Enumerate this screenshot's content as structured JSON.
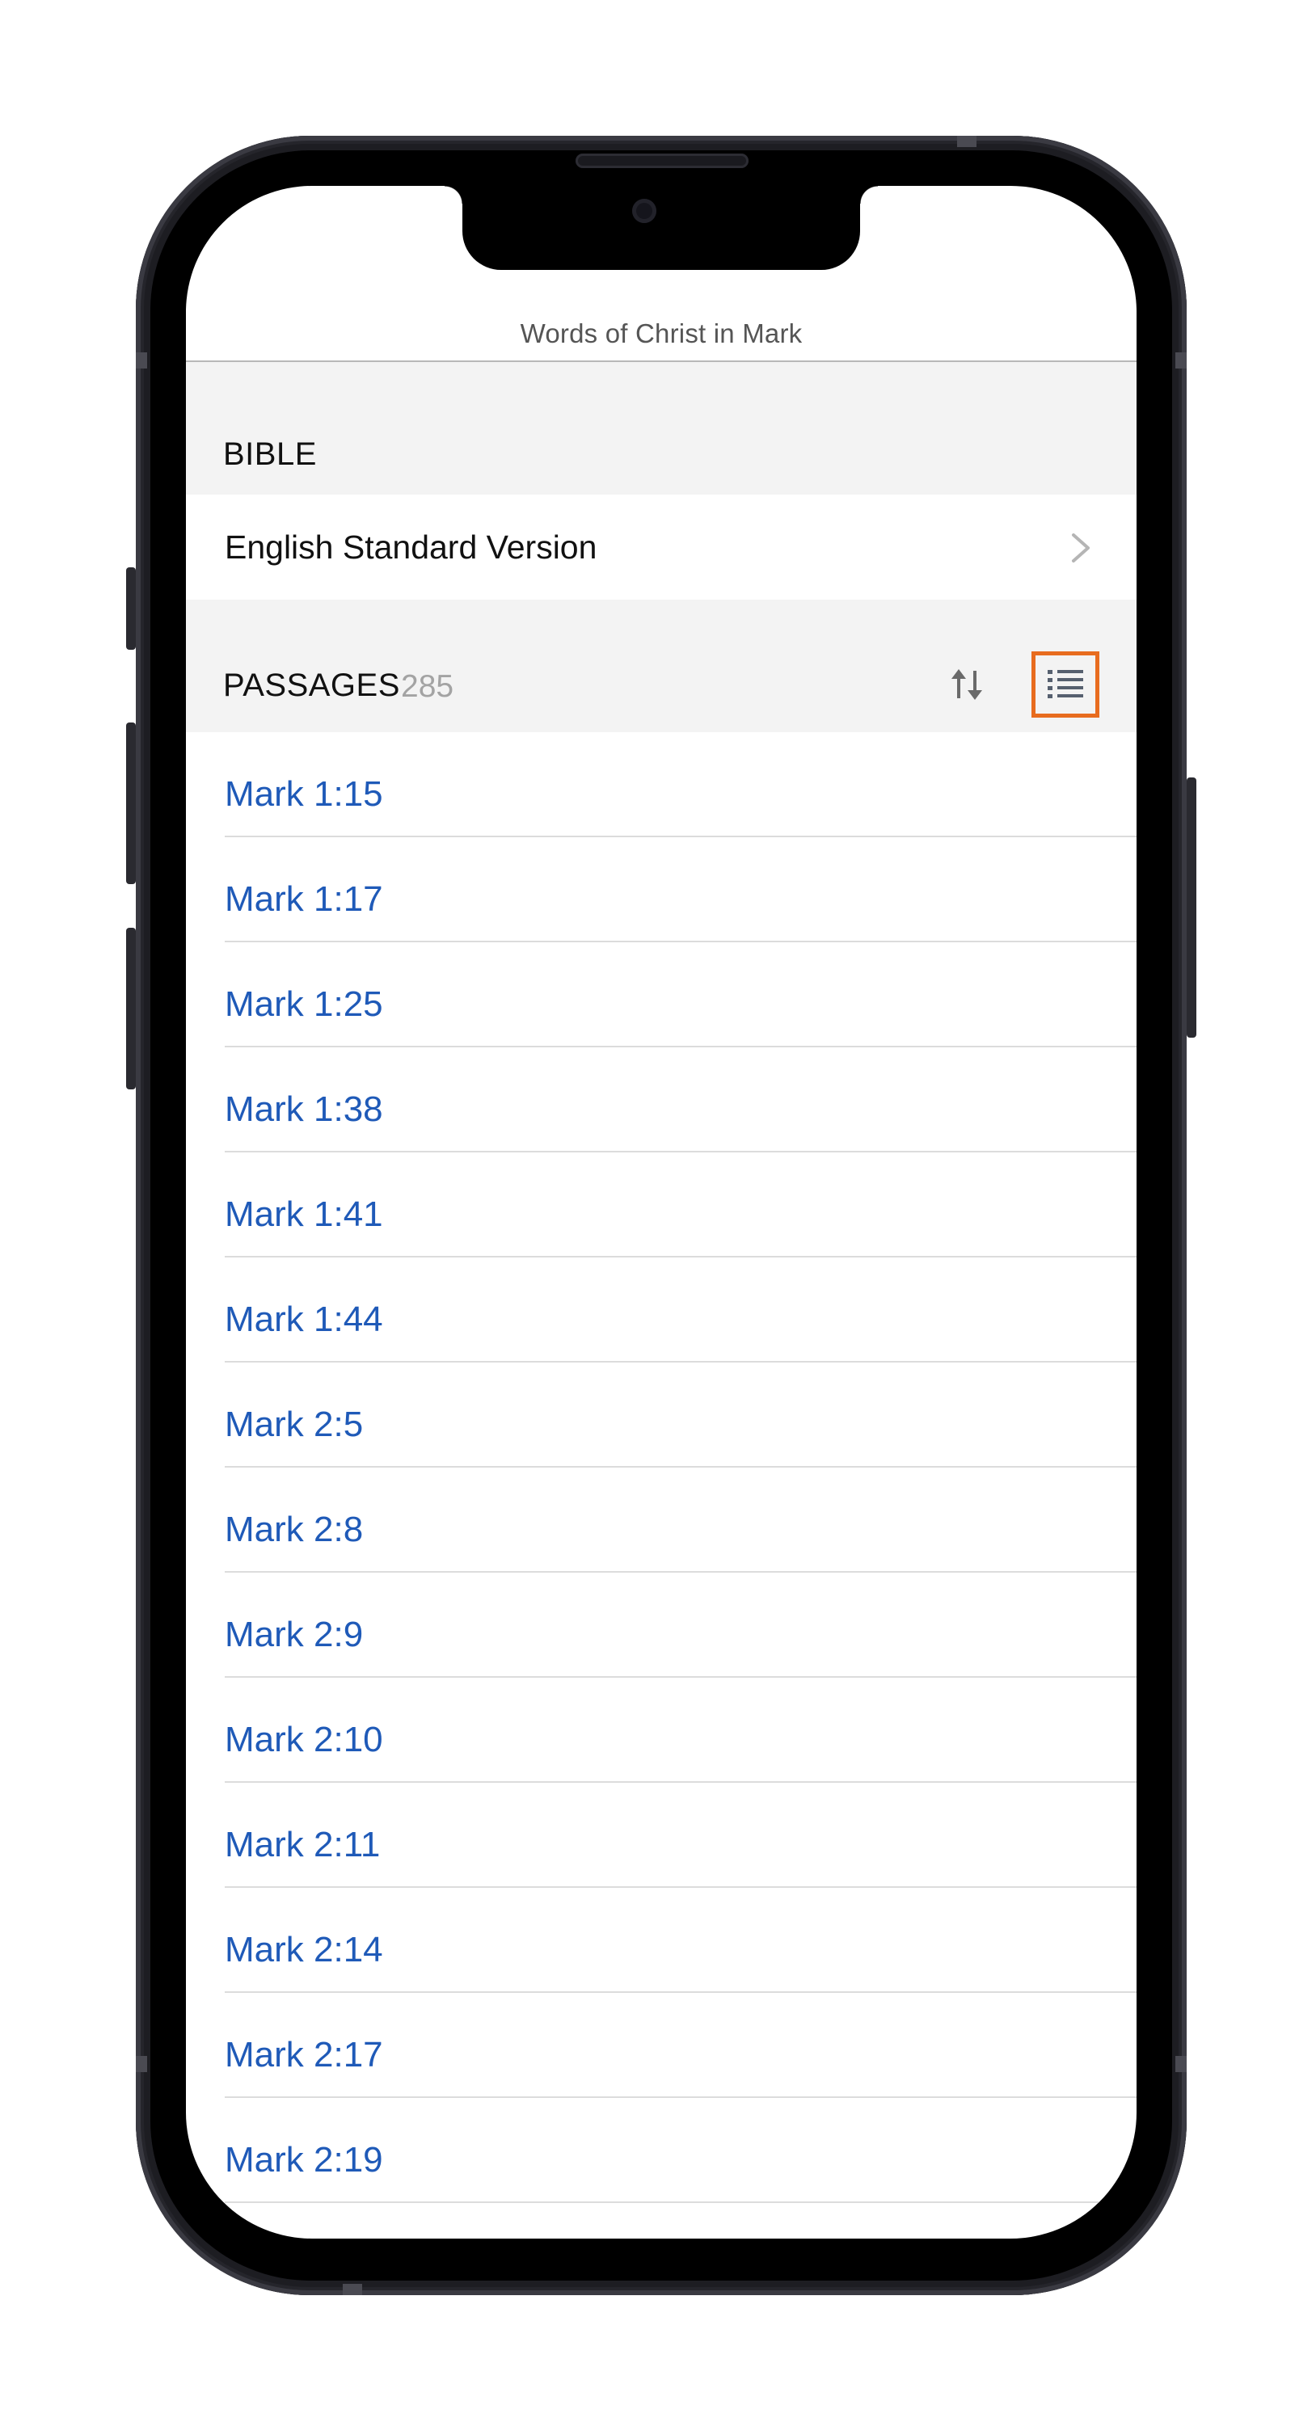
{
  "app": {
    "nav_title": "Words of Christ in Mark"
  },
  "bible_section": {
    "header": "BIBLE",
    "version_label": "English Standard Version"
  },
  "passages_section": {
    "header": "PASSAGES",
    "count": "285",
    "sort_icon": "sort-arrows-icon",
    "view_icon": "list-view-icon"
  },
  "passages": [
    {
      "label": "Mark 1:15"
    },
    {
      "label": "Mark 1:17"
    },
    {
      "label": "Mark 1:25"
    },
    {
      "label": "Mark 1:38"
    },
    {
      "label": "Mark 1:41"
    },
    {
      "label": "Mark 1:44"
    },
    {
      "label": "Mark 2:5"
    },
    {
      "label": "Mark 2:8"
    },
    {
      "label": "Mark 2:9"
    },
    {
      "label": "Mark 2:10"
    },
    {
      "label": "Mark 2:11"
    },
    {
      "label": "Mark 2:14"
    },
    {
      "label": "Mark 2:17"
    },
    {
      "label": "Mark 2:19"
    }
  ],
  "colors": {
    "link": "#1f5ab8",
    "highlight_box": "#e86c1f",
    "section_bg": "#f3f3f3"
  }
}
